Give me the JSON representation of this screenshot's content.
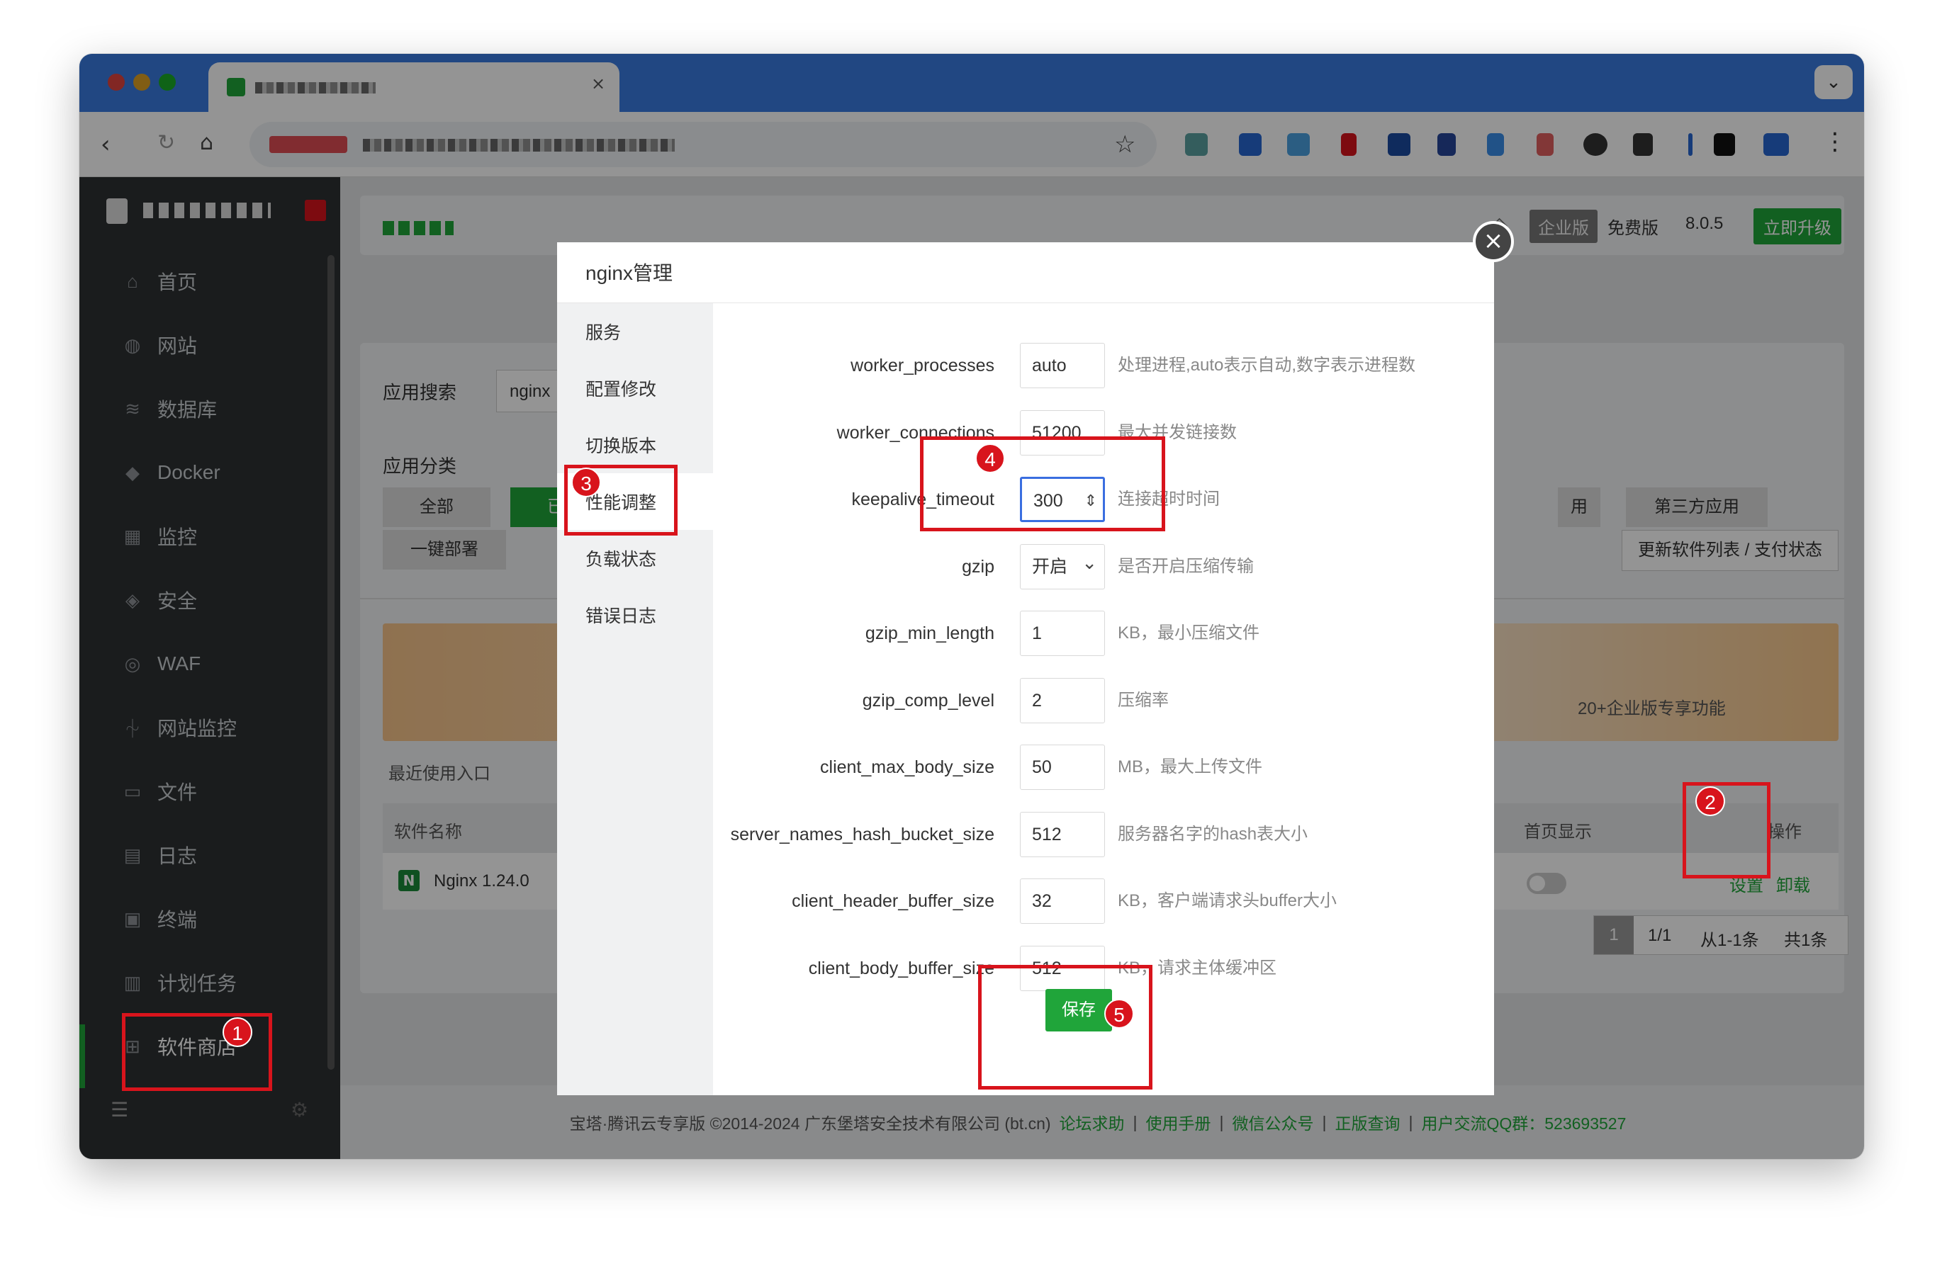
{
  "browser": {
    "menu_icon": "chevron-down-icon"
  },
  "sidebar": {
    "items": [
      {
        "label": "首页",
        "icon": "⌂"
      },
      {
        "label": "网站",
        "icon": "◍"
      },
      {
        "label": "数据库",
        "icon": "≋"
      },
      {
        "label": "Docker",
        "icon": "◆"
      },
      {
        "label": "监控",
        "icon": "▦"
      },
      {
        "label": "安全",
        "icon": "◈"
      },
      {
        "label": "WAF",
        "icon": "◎"
      },
      {
        "label": "网站监控",
        "icon": "⏆"
      },
      {
        "label": "文件",
        "icon": "▭"
      },
      {
        "label": "日志",
        "icon": "▤"
      },
      {
        "label": "终端",
        "icon": "▣"
      },
      {
        "label": "计划任务",
        "icon": "▥"
      },
      {
        "label": "软件商店",
        "icon": "⊞"
      }
    ]
  },
  "header": {
    "enterprise": "企业版",
    "free": "免费版",
    "version": "8.0.5",
    "upgrade": "立即升级"
  },
  "store": {
    "search_label": "应用搜索",
    "search_value": "nginx",
    "category_label": "应用分类",
    "cat_all": "全部",
    "cat_installed": "已安",
    "cat_used": "用",
    "cat_third": "第三方应用",
    "cat_deploy": "一键部署",
    "update_btn": "更新软件列表 / 支付状态",
    "banner_text": "20+企业版专享功能",
    "recent": "最近使用入口",
    "col_name": "软件名称",
    "col_home": "首页显示",
    "col_ops": "操作",
    "row_name": "Nginx 1.24.0",
    "op_settings": "设置",
    "op_uninstall": "卸载",
    "pg_current": "1",
    "pg_total": "1/1",
    "pg_range": "从1-1条",
    "pg_count": "共1条"
  },
  "modal": {
    "title": "nginx管理",
    "nav": [
      "服务",
      "配置修改",
      "切换版本",
      "性能调整",
      "负载状态",
      "错误日志"
    ],
    "fields": [
      {
        "label": "worker_processes",
        "value": "auto",
        "desc": "处理进程,auto表示自动,数字表示进程数"
      },
      {
        "label": "worker_connections",
        "value": "51200",
        "desc": "最大并发链接数"
      },
      {
        "label": "keepalive_timeout",
        "value": "300",
        "desc": "连接超时时间"
      },
      {
        "label": "gzip",
        "value": "开启",
        "desc": "是否开启压缩传输"
      },
      {
        "label": "gzip_min_length",
        "value": "1",
        "desc": "KB，最小压缩文件"
      },
      {
        "label": "gzip_comp_level",
        "value": "2",
        "desc": "压缩率"
      },
      {
        "label": "client_max_body_size",
        "value": "50",
        "desc": "MB，最大上传文件"
      },
      {
        "label": "server_names_hash_bucket_size",
        "value": "512",
        "desc": "服务器名字的hash表大小"
      },
      {
        "label": "client_header_buffer_size",
        "value": "32",
        "desc": "KB，客户端请求头buffer大小"
      },
      {
        "label": "client_body_buffer_size",
        "value": "512",
        "desc": "KB，请求主体缓冲区"
      }
    ],
    "save": "保存"
  },
  "annotations": [
    "1",
    "2",
    "3",
    "4",
    "5"
  ],
  "footer": {
    "copyright": "宝塔·腾讯云专享版 ©2014-2024 广东堡塔安全技术有限公司 (bt.cn)",
    "links": [
      "论坛求助",
      "使用手册",
      "微信公众号",
      "正版查询",
      "用户交流QQ群：523693527"
    ]
  },
  "colors": {
    "accent": "#20a53a",
    "annotation": "#d8141c",
    "tabbar": "#3a7be0",
    "sidebar": "#2e3133"
  }
}
